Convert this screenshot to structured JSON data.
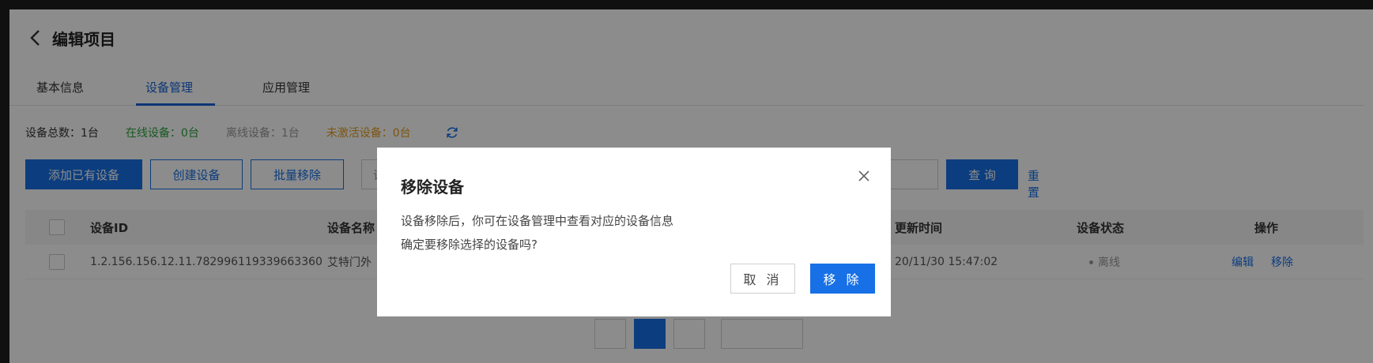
{
  "header": {
    "title": "编辑项目"
  },
  "tabs": [
    {
      "label": "基本信息"
    },
    {
      "label": "设备管理"
    },
    {
      "label": "应用管理"
    }
  ],
  "stats": {
    "total": "设备总数：1台",
    "online": "在线设备：0台",
    "offline": "离线设备：1台",
    "inactive": "未激活设备：0台"
  },
  "toolbar": {
    "add_existing": "添加已有设备",
    "create": "创建设备",
    "batch_remove": "批量移除",
    "search_placeholder": "请",
    "query": "查 询",
    "reset": "重置"
  },
  "table": {
    "columns": [
      "设备ID",
      "设备名称",
      "更新时间",
      "设备状态",
      "操作"
    ],
    "rows": [
      {
        "device_id": "1.2.156.156.12.11.782996119339663360",
        "device_name": "艾特门外",
        "updated": "20/11/30 15:47:02",
        "status": "离线",
        "edit": "编辑",
        "remove": "移除"
      }
    ]
  },
  "dialog": {
    "title": "移除设备",
    "line1": "设备移除后，你可在设备管理中查看对应的设备信息",
    "line2": "确定要移除选择的设备吗?",
    "cancel": "取 消",
    "confirm": "移 除"
  },
  "colors": {
    "primary": "#1770e6",
    "online": "#2aa33b",
    "inactive": "#e49b1a",
    "offline": "#999999"
  },
  "icons": [
    "back-arrow-icon",
    "refresh-icon",
    "close-icon"
  ]
}
